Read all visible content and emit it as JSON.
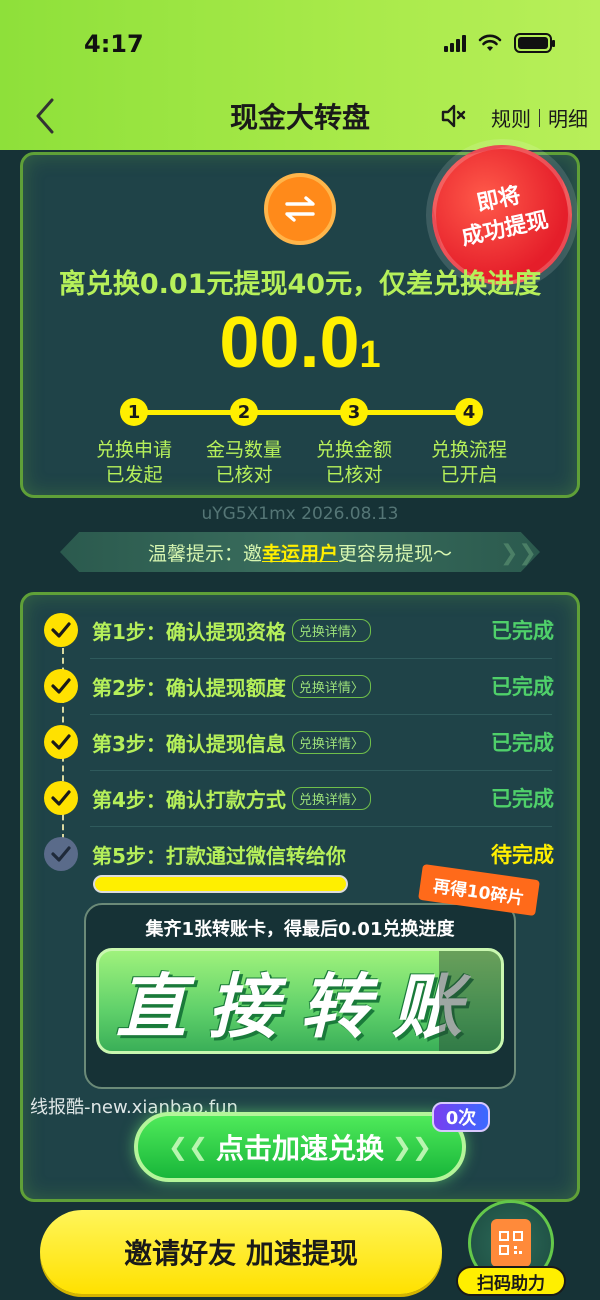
{
  "status_bar": {
    "time": "4:17"
  },
  "nav": {
    "title": "现金大转盘",
    "rules_label": "规则",
    "details_label": "明细"
  },
  "summary": {
    "stamp_line1": "即将",
    "stamp_line2": "成功提现",
    "headline": "离兑换0.01元提现40元，仅差兑换进度",
    "progress_main": "00.0",
    "progress_tail": "1",
    "steps": [
      {
        "num": "1",
        "line1": "兑换申请",
        "line2": "已发起"
      },
      {
        "num": "2",
        "line1": "金马数量",
        "line2": "已核对"
      },
      {
        "num": "3",
        "line1": "兑换金额",
        "line2": "已核对"
      },
      {
        "num": "4",
        "line1": "兑换流程",
        "line2": "已开启"
      }
    ]
  },
  "user_stamp": "uYG5X1mx 2026.08.13",
  "tip": {
    "prefix": "温馨提示：邀",
    "highlight": "幸运用户",
    "suffix": "更容易提现～"
  },
  "checklist": {
    "detail_label": "兑换详情〉",
    "rows": [
      {
        "text": "第1步：确认提现资格",
        "status": "已完成"
      },
      {
        "text": "第2步：确认提现额度",
        "status": "已完成"
      },
      {
        "text": "第3步：确认提现信息",
        "status": "已完成"
      },
      {
        "text": "第4步：确认打款方式",
        "status": "已完成"
      },
      {
        "text": "第5步：打款通过微信转给你",
        "status": "待完成"
      }
    ],
    "step5_progress": 0.85
  },
  "popup": {
    "reward_tag": "再得10碎片",
    "title": "集齐1张转账卡，得最后0.01兑换进度",
    "transfer_label": "直接转账"
  },
  "watermark": "线报酷-new.xianbao.fun",
  "accelerate": {
    "label": "点击加速兑换",
    "count_badge": "0次"
  },
  "bottom": {
    "invite_label": "邀请好友 加速提现",
    "scan_label": "扫码助力"
  },
  "colors": {
    "accent_green": "#b6f05a",
    "accent_yellow": "#ffef00",
    "done_green": "#4fd06a",
    "background": "#163236"
  }
}
